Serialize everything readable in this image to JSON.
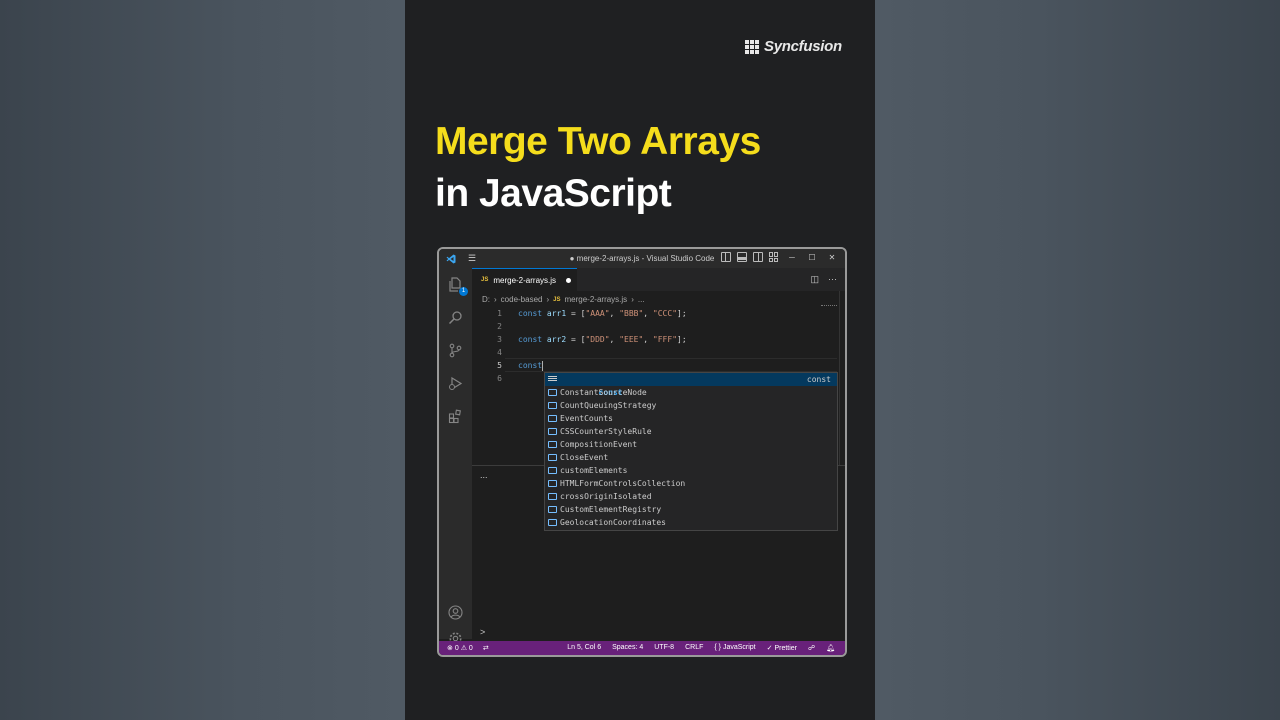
{
  "brand": {
    "name": "Syncfusion"
  },
  "headline": {
    "line1": "Merge Two Arrays",
    "line2": "in JavaScript"
  },
  "window": {
    "title": "● merge-2-arrays.js - Visual Studio Code",
    "menu_icon": "hamburger-icon"
  },
  "activity_bar": {
    "explorer_badge": "1"
  },
  "tab": {
    "js_label": "JS",
    "filename": "merge-2-arrays.js"
  },
  "breadcrumb": {
    "drive": "D:",
    "folder": "code-based",
    "js_label": "JS",
    "file": "merge-2-arrays.js",
    "more": "..."
  },
  "editor": {
    "line_numbers": [
      "1",
      "2",
      "3",
      "4",
      "5",
      "6"
    ],
    "line1": {
      "kw": "const",
      "var": "arr1",
      "op": " = [",
      "s1": "\"AAA\"",
      "s2": "\"BBB\"",
      "s3": "\"CCC\"",
      "end": "];"
    },
    "line3": {
      "kw": "const",
      "var": "arr2",
      "op": " = [",
      "s1": "\"DDD\"",
      "s2": "\"EEE\"",
      "s3": "\"FFF\"",
      "end": "];"
    },
    "line5": {
      "kw": "const"
    },
    "sep": ", "
  },
  "suggest": {
    "detail": "const",
    "items": [
      "const",
      "ConstantSourceNode",
      "CountQueuingStrategy",
      "EventCounts",
      "CSSCounterStyleRule",
      "CompositionEvent",
      "CloseEvent",
      "customElements",
      "HTMLFormControlsCollection",
      "crossOriginIsolated",
      "CustomElementRegistry",
      "GeolocationCoordinates"
    ]
  },
  "panel": {
    "dots": "...",
    "prompt": ">"
  },
  "status_bar": {
    "errors": "0",
    "warnings": "0",
    "position": "Ln 5, Col 6",
    "spaces": "Spaces: 4",
    "encoding": "UTF-8",
    "eol": "CRLF",
    "language": "JavaScript",
    "formatter": "Prettier"
  },
  "colors": {
    "status_bar": "#68217a",
    "headline": "#f5dd1c",
    "accent": "#0078d4"
  }
}
